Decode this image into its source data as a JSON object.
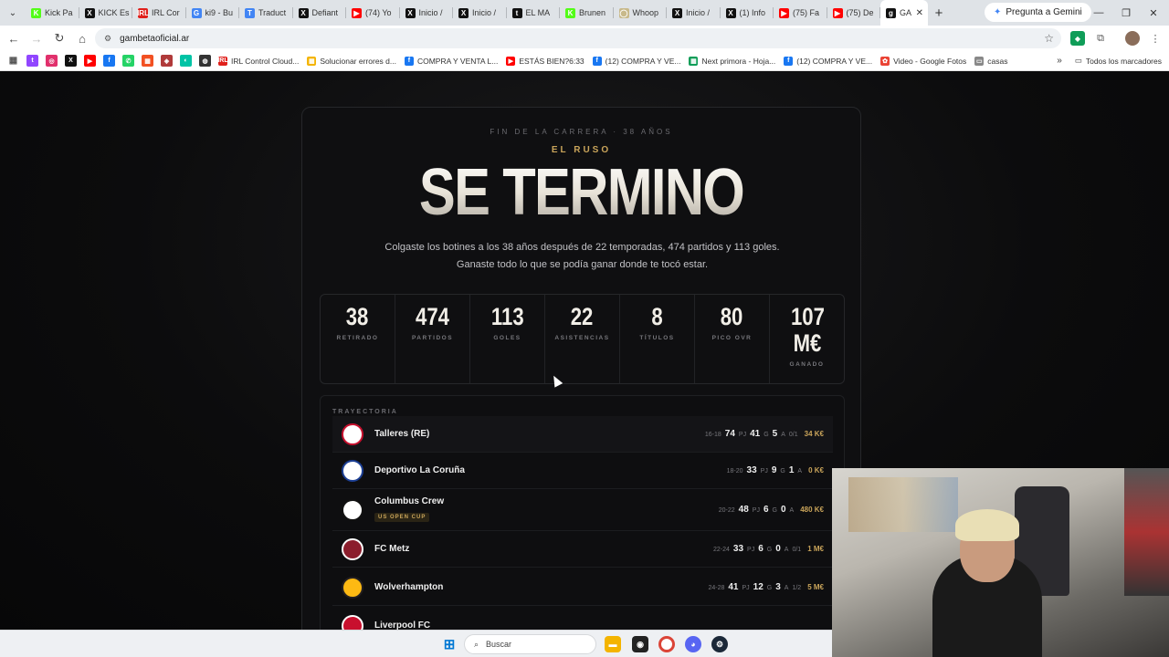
{
  "browser": {
    "tabs": [
      {
        "title": "Kick Pa",
        "fav_text": "K",
        "fav_color": "#53fc18"
      },
      {
        "title": "KICK Es",
        "fav_text": "X",
        "fav_color": "#111111"
      },
      {
        "title": "IRL Cor",
        "fav_text": "IRL",
        "fav_color": "#e0201b"
      },
      {
        "title": "ki9 - Bu",
        "fav_text": "G",
        "fav_color": "#4285f4"
      },
      {
        "title": "Traduct",
        "fav_text": "T",
        "fav_color": "#4285f4"
      },
      {
        "title": "Defiant",
        "fav_text": "X",
        "fav_color": "#111111"
      },
      {
        "title": "(74) Yo",
        "fav_text": "▶",
        "fav_color": "#ff0000"
      },
      {
        "title": "Inicio /",
        "fav_text": "X",
        "fav_color": "#111111"
      },
      {
        "title": "Inicio /",
        "fav_text": "X",
        "fav_color": "#111111"
      },
      {
        "title": "EL MA",
        "fav_text": "t",
        "fav_color": "#111111"
      },
      {
        "title": "Brunen",
        "fav_text": "K",
        "fav_color": "#53fc18"
      },
      {
        "title": "Whoop",
        "fav_text": "◯",
        "fav_color": "#c8b98a"
      },
      {
        "title": "Inicio /",
        "fav_text": "X",
        "fav_color": "#111111"
      },
      {
        "title": "(1) Info",
        "fav_text": "X",
        "fav_color": "#111111"
      },
      {
        "title": "(75) Fa",
        "fav_text": "▶",
        "fav_color": "#ff0000"
      },
      {
        "title": "(75) De",
        "fav_text": "▶",
        "fav_color": "#ff0000"
      }
    ],
    "active_tab": {
      "title": "GA",
      "fav_text": "g",
      "fav_color": "#111111"
    },
    "gemini_label": "Pregunta a Gemini",
    "url": "gambetaoficial.ar",
    "bookmarks": [
      {
        "label": "IRL Control Cloud...",
        "fav_text": "IRL",
        "fav_color": "#e0201b"
      },
      {
        "label": "Solucionar errores d...",
        "fav_text": "▦",
        "fav_color": "#f4b400"
      },
      {
        "label": "COMPRA Y VENTA L...",
        "fav_text": "f",
        "fav_color": "#1877f2"
      },
      {
        "label": "ESTÁS BIEN?6:33",
        "fav_text": "▶",
        "fav_color": "#ff0000"
      },
      {
        "label": "(12) COMPRA Y VE...",
        "fav_text": "f",
        "fav_color": "#1877f2"
      },
      {
        "label": "Next primora - Hoja...",
        "fav_text": "▦",
        "fav_color": "#0f9d58"
      },
      {
        "label": "(12) COMPRA Y VE...",
        "fav_text": "f",
        "fav_color": "#1877f2"
      },
      {
        "label": "Video - Google Fotos",
        "fav_text": "✿",
        "fav_color": "#ea4335"
      },
      {
        "label": "casas",
        "fav_text": "▭",
        "fav_color": "#888888"
      }
    ],
    "all_bookmarks": "Todos los marcadores",
    "bookmark_icons": [
      {
        "fav_text": "t",
        "fav_color": "#9146ff"
      },
      {
        "fav_text": "◎",
        "fav_color": "#e1306c"
      },
      {
        "fav_text": "X",
        "fav_color": "#111111"
      },
      {
        "fav_text": "▶",
        "fav_color": "#ff0000"
      },
      {
        "fav_text": "f",
        "fav_color": "#1877f2"
      },
      {
        "fav_text": "✆",
        "fav_color": "#25d366"
      },
      {
        "fav_text": "▦",
        "fav_color": "#f25022"
      },
      {
        "fav_text": "◈",
        "fav_color": "#b03a3a"
      },
      {
        "fav_text": "◐",
        "fav_color": "#00c3a5"
      },
      {
        "fav_text": "◍",
        "fav_color": "#333333"
      }
    ]
  },
  "page": {
    "kicker": "FIN DE LA CARRERA · 38 AÑOS",
    "nickname": "EL RUSO",
    "headline": "SE TERMINO",
    "description": "Colgaste los botines a los 38 años después de 22 temporadas, 474 partidos y 113 goles. Ganaste todo lo que se podía ganar donde te tocó estar.",
    "stats": [
      {
        "value": "38",
        "label": "RETIRADO"
      },
      {
        "value": "474",
        "label": "PARTIDOS"
      },
      {
        "value": "113",
        "label": "GOLES"
      },
      {
        "value": "22",
        "label": "ASISTENCIAS"
      },
      {
        "value": "8",
        "label": "TÍTULOS"
      },
      {
        "value": "80",
        "label": "PICO OVR"
      },
      {
        "value": "107 M€",
        "label": "GANADO"
      }
    ],
    "trajectory_title": "TRAYECTORIA",
    "clubs": [
      {
        "name": "Talleres (RE)",
        "badge": "",
        "years": "16-18",
        "pj": "74",
        "g": "41",
        "a": "5",
        "titles": "0/1",
        "money": "34 K€",
        "crest_color": "#c8102e",
        "crest_bg": "#ffffff"
      },
      {
        "name": "Deportivo La Coruña",
        "badge": "",
        "years": "18-20",
        "pj": "33",
        "g": "9",
        "a": "1",
        "titles": "",
        "money": "0 K€",
        "crest_color": "#1c3f94",
        "crest_bg": "#ffffff"
      },
      {
        "name": "Columbus Crew",
        "badge": "US OPEN CUP",
        "years": "20-22",
        "pj": "48",
        "g": "6",
        "a": "0",
        "titles": "",
        "money": "480 K€",
        "crest_color": "#111111",
        "crest_bg": "#ffffff"
      },
      {
        "name": "FC Metz",
        "badge": "",
        "years": "22-24",
        "pj": "33",
        "g": "6",
        "a": "0",
        "titles": "0/1",
        "money": "1 M€",
        "crest_color": "#ffffff",
        "crest_bg": "#8b1d2c"
      },
      {
        "name": "Wolverhampton",
        "badge": "",
        "years": "24-28",
        "pj": "41",
        "g": "12",
        "a": "3",
        "titles": "1/2",
        "money": "5 M€",
        "crest_color": "#231f20",
        "crest_bg": "#fdb913"
      },
      {
        "name": "Liverpool FC",
        "badge": "",
        "years": "",
        "pj": "",
        "g": "",
        "a": "",
        "titles": "",
        "money": "",
        "crest_color": "#ffffff",
        "crest_bg": "#c8102e"
      }
    ]
  },
  "taskbar": {
    "search_placeholder": "Buscar"
  }
}
